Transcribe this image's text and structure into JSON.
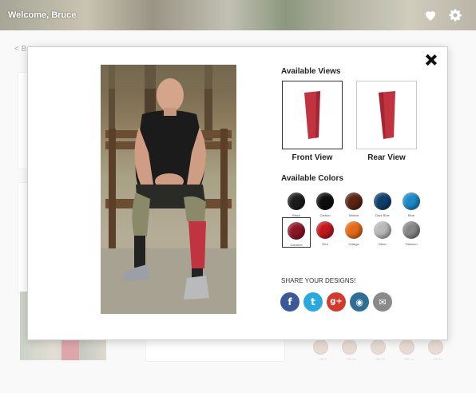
{
  "header": {
    "welcome": "Welcome, Bruce",
    "icons": [
      "heart-icon",
      "gear-icon"
    ]
  },
  "background": {
    "back_link": "< B",
    "skin_swatch_labels": [
      "OB 8",
      "OB 10",
      "OB 12",
      "OB 14",
      "OB 16"
    ],
    "skin_swatch_color": "#c9b19e"
  },
  "modal": {
    "available_views_title": "Available Views",
    "views": [
      {
        "label": "Front View",
        "selected": true
      },
      {
        "label": "Rear View",
        "selected": false
      }
    ],
    "available_colors_title": "Available Colors",
    "colors": [
      {
        "name": "Black",
        "hex": "#1c1c1c"
      },
      {
        "name": "Carbon",
        "hex": "#0d0d0d"
      },
      {
        "name": "Walnut",
        "hex": "#5a2412"
      },
      {
        "name": "Dark Blue",
        "hex": "#0f3e6d"
      },
      {
        "name": "Blue",
        "hex": "#1c89c8"
      },
      {
        "name": "Carmine",
        "hex": "#8c1522",
        "selected": true
      },
      {
        "name": "Red",
        "hex": "#c2171c"
      },
      {
        "name": "Orange",
        "hex": "#e56a17"
      },
      {
        "name": "Silver",
        "hex": "#b9b9b9"
      },
      {
        "name": "Titanium",
        "hex": "#868686"
      }
    ],
    "product_color": "#c0333f",
    "share_title": "SHARE YOUR DESIGNS!",
    "share": [
      {
        "name": "facebook-icon",
        "glyph": "f",
        "color": "#3b5998"
      },
      {
        "name": "twitter-icon",
        "glyph": "t",
        "color": "#2aa8e0"
      },
      {
        "name": "google-plus-icon",
        "glyph": "g+",
        "color": "#d23b2c"
      },
      {
        "name": "instagram-icon",
        "glyph": "◉",
        "color": "#2f6f96"
      },
      {
        "name": "email-icon",
        "glyph": "✉",
        "color": "#8a8a8a"
      }
    ]
  }
}
